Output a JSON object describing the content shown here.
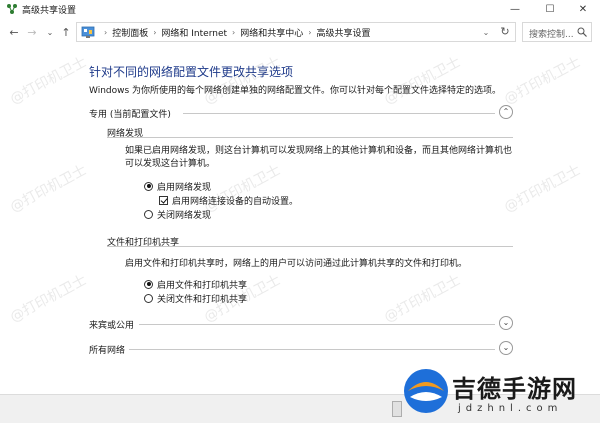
{
  "window": {
    "title": "高级共享设置",
    "minimize_glyph": "—",
    "maximize_glyph": "☐",
    "close_glyph": "✕"
  },
  "nav": {
    "back_glyph": "←",
    "forward_glyph": "→",
    "recent_glyph": "⌄",
    "up_glyph": "↑",
    "separator_glyph": "›",
    "breadcrumb": [
      "控制面板",
      "网络和 Internet",
      "网络和共享中心",
      "高级共享设置"
    ],
    "dropdown_glyph": "⌄",
    "refresh_glyph": "↻",
    "search_placeholder": "搜索控制..."
  },
  "main": {
    "heading": "针对不同的网络配置文件更改共享选项",
    "description": "Windows 为你所使用的每个网络创建单独的网络配置文件。你可以针对每个配置文件选择特定的选项。",
    "profiles": [
      {
        "label": "专用 (当前配置文件)",
        "expanded": true,
        "chevron": "⌃",
        "groups": [
          {
            "label": "网络发现",
            "text": "如果已启用网络发现，则这台计算机可以发现网络上的其他计算机和设备，而且其他网络计算机也可以发现这台计算机。",
            "options": [
              {
                "type": "radio",
                "label": "启用网络发现",
                "selected": true
              },
              {
                "type": "checkbox",
                "label": "启用网络连接设备的自动设置。",
                "checked": true
              },
              {
                "type": "radio",
                "label": "关闭网络发现",
                "selected": false
              }
            ]
          },
          {
            "label": "文件和打印机共享",
            "text": "启用文件和打印机共享时，网络上的用户可以访问通过此计算机共享的文件和打印机。",
            "options": [
              {
                "type": "radio",
                "label": "启用文件和打印机共享",
                "selected": true
              },
              {
                "type": "radio",
                "label": "关闭文件和打印机共享",
                "selected": false
              }
            ]
          }
        ]
      },
      {
        "label": "来宾或公用",
        "expanded": false,
        "chevron": "⌄"
      },
      {
        "label": "所有网络",
        "expanded": false,
        "chevron": "⌄"
      }
    ]
  },
  "watermark": "@打印机卫士",
  "logo": {
    "text": "吉德手游网",
    "url_text": "jdzhnl.com"
  },
  "colors": {
    "heading": "#1e3a8a",
    "window_icon": "#2e7d32",
    "logo_blue": "#1e6fd9",
    "logo_orange": "#f29a1f"
  }
}
